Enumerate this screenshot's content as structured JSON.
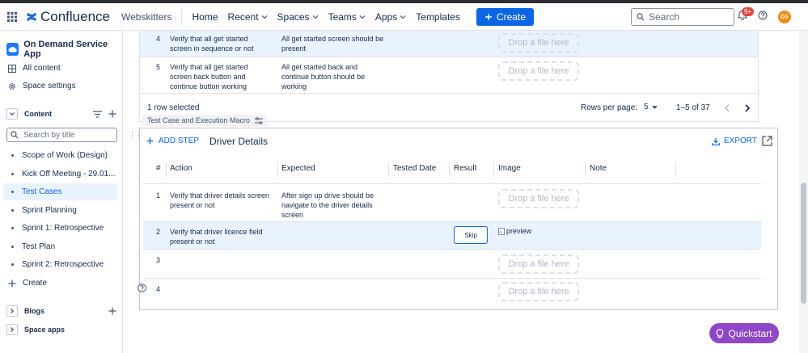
{
  "nav": {
    "product": "Confluence",
    "site": "Webskitters",
    "items": [
      {
        "label": "Home",
        "dropdown": false
      },
      {
        "label": "Recent",
        "dropdown": true
      },
      {
        "label": "Spaces",
        "dropdown": true
      },
      {
        "label": "Teams",
        "dropdown": true
      },
      {
        "label": "Apps",
        "dropdown": true
      },
      {
        "label": "Templates",
        "dropdown": false
      }
    ],
    "create_label": "Create",
    "search_placeholder": "Search",
    "notification_badge": "9+",
    "avatar_initials": "DS"
  },
  "sidebar": {
    "space_title": "On Demand Service App",
    "links": [
      "All content",
      "Space settings"
    ],
    "content_label": "Content",
    "search_placeholder": "Search by title",
    "tree": [
      {
        "label": "Scope of Work (Design)",
        "active": false
      },
      {
        "label": "Kick Off Meeting - 29.01...",
        "active": false
      },
      {
        "label": "Test Cases",
        "active": true
      },
      {
        "label": "Sprint Planning",
        "active": false
      },
      {
        "label": "Sprint 1: Retrospective",
        "active": false
      },
      {
        "label": "Test Plan",
        "active": false
      },
      {
        "label": "Sprint 2: Retrospective",
        "active": false
      }
    ],
    "create_label": "Create",
    "blogs_label": "Blogs",
    "space_apps_label": "Space apps"
  },
  "table1": {
    "rows": [
      {
        "num": "4",
        "action": [
          "Verify that all get started",
          "screen in sequence or not"
        ],
        "expected": [
          "All get started screen should be",
          "present"
        ],
        "drop": "Drop a file here"
      },
      {
        "num": "5",
        "action": [
          "Verify that all get started",
          "screen back button and",
          "continue button working"
        ],
        "expected": [
          "All get started back and",
          "continue button should be",
          "working"
        ],
        "drop": "Drop a file here"
      }
    ],
    "selected": "1 row selected",
    "rows_per_page_label": "Rows per page:",
    "rows_per_page": "5",
    "range": "1–5 of 37"
  },
  "macro_label": "Test Case and Execution Macro",
  "table2": {
    "add_step": "ADD STEP",
    "title": "Driver Details",
    "export": "EXPORT",
    "headers": [
      "#",
      "Action",
      "Expected",
      "Tested Date",
      "Result",
      "Image",
      "Note"
    ],
    "rows": [
      {
        "num": "1",
        "action": [
          "Verify that driver details screen",
          "present or not"
        ],
        "expected": [
          "After sign up drive should be",
          "navigate to the driver details",
          "screen"
        ],
        "drop": "Drop a file here"
      },
      {
        "num": "2",
        "action": [
          "Verify that driver licence field",
          "present or not"
        ],
        "expected": [],
        "result": "Skip",
        "image": "preview"
      },
      {
        "num": "3",
        "action": [],
        "expected": [],
        "drop": "Drop a file here"
      },
      {
        "num": "4",
        "action": [],
        "expected": [],
        "drop": "Drop a file here"
      }
    ]
  },
  "quickstart": "Quickstart",
  "colors": {
    "accent": "#0c66e4",
    "selected_row": "#e9f2ff",
    "quickstart": "#8f46c7"
  }
}
